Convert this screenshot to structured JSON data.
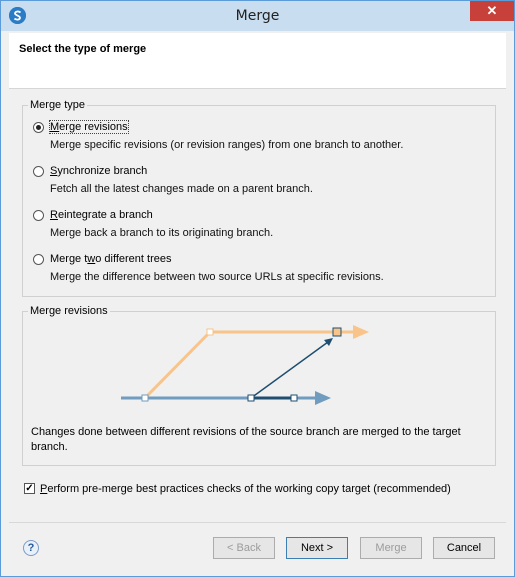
{
  "window": {
    "title": "Merge",
    "close_glyph": "✕"
  },
  "header": {
    "title": "Select the type of merge"
  },
  "merge_type": {
    "legend": "Merge type",
    "options": [
      {
        "label_pre": "",
        "label_key": "M",
        "label_post": "erge revisions",
        "description": "Merge specific revisions (or revision ranges) from one branch to another.",
        "selected": true
      },
      {
        "label_pre": "",
        "label_key": "S",
        "label_post": "ynchronize branch",
        "description": "Fetch all the latest changes made on a parent branch.",
        "selected": false
      },
      {
        "label_pre": "",
        "label_key": "R",
        "label_post": "eintegrate a branch",
        "description": "Merge back a branch to its originating branch.",
        "selected": false
      },
      {
        "label_pre": "Merge t",
        "label_key": "w",
        "label_post": "o different trees",
        "description": "Merge the difference between two source URLs at specific revisions.",
        "selected": false
      }
    ]
  },
  "merge_revisions_panel": {
    "legend": "Merge revisions",
    "description_line1": "Changes done between different revisions of the source branch are merged to the target",
    "description_line2": "branch."
  },
  "precheck": {
    "label_key": "P",
    "label_post": "erform pre-merge best practices checks of the working copy target (recommended)",
    "checked": true
  },
  "buttons": {
    "back": "< Back",
    "back_key": "B",
    "next": "Next >",
    "merge": "Merge",
    "cancel": "Cancel"
  },
  "colors": {
    "source_branch": "#6f9cbf",
    "source_branch_dark": "#1e4e70",
    "target_branch": "#f9c48a",
    "accent": "#2b7cc7"
  }
}
